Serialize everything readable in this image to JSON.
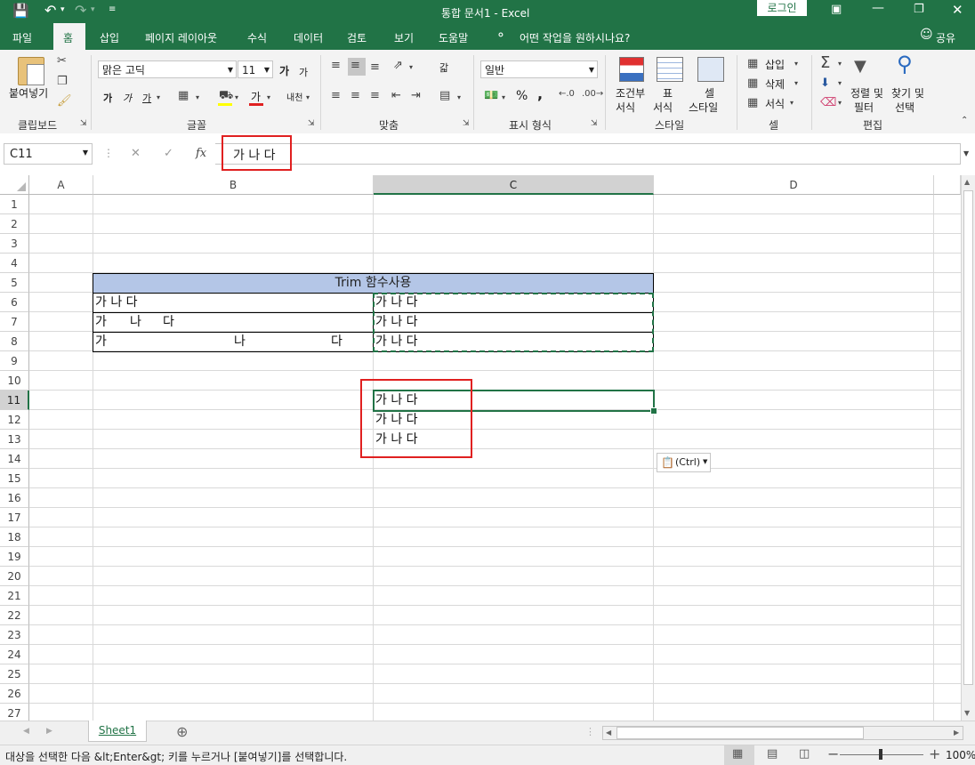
{
  "titlebar": {
    "document_title": "통합 문서1  -  Excel",
    "login_label": "로그인"
  },
  "tabs": [
    "파일",
    "홈",
    "삽입",
    "페이지 레이아웃",
    "수식",
    "데이터",
    "검토",
    "보기",
    "도움말"
  ],
  "tell_me": "어떤 작업을 원하시나요?",
  "share": "공유",
  "ribbon": {
    "clipboard": {
      "paste_label": "붙여넣기",
      "group_label": "클립보드"
    },
    "font": {
      "font_name": "맑은 고딕",
      "font_size": "11",
      "group_label": "글꼴",
      "bold": "가",
      "italic": "가",
      "underline": "가",
      "font_color": "가",
      "grow": "가",
      "shrink": "가",
      "phonetic": "내천"
    },
    "alignment": {
      "group_label": "맞춤",
      "wrap": "갋"
    },
    "number": {
      "format": "일반",
      "group_label": "표시 형식",
      "percent": "%",
      "comma": ","
    },
    "styles": {
      "conditional": "조건부\n서식",
      "conditional_l1": "조건부",
      "conditional_l2": "서식",
      "table_l1": "표",
      "table_l2": "서식",
      "cell_l1": "셀",
      "cell_l2": "스타일",
      "group_label": "스타일"
    },
    "cells": {
      "insert": "삽입",
      "delete": "삭제",
      "format": "서식",
      "group_label": "셀"
    },
    "editing": {
      "sort_l1": "정렬 및",
      "sort_l2": "필터",
      "find_l1": "찾기 및",
      "find_l2": "선택",
      "group_label": "편집"
    }
  },
  "formula_bar": {
    "name_box": "C11",
    "fx": "fx",
    "value": "가 나 다"
  },
  "columns": [
    "A",
    "B",
    "C",
    "D"
  ],
  "rows": [
    "1",
    "2",
    "3",
    "4",
    "5",
    "6",
    "7",
    "8",
    "9",
    "10",
    "11",
    "12",
    "13",
    "14",
    "15",
    "16",
    "17",
    "18",
    "19",
    "20",
    "21",
    "22",
    "23",
    "24",
    "25",
    "26",
    "27"
  ],
  "table": {
    "header": "Trim 함수사용",
    "b6": "가 나 다",
    "b7_1": "가",
    "b7_2": "나",
    "b7_3": "다",
    "b8_1": "가",
    "b8_2": "나",
    "b8_3": "다",
    "c6": "가 나 다",
    "c7": "가 나 다",
    "c8": "가 나 다",
    "c11": "가 나 다",
    "c12": "가 나 다",
    "c13": "가 나 다"
  },
  "paste_options": "(Ctrl)",
  "sheet_tab": "Sheet1",
  "status_text": "대상을 선택한 다음 &lt;Enter&gt; 키를 누르거나 [붙여넣기]를 선택합니다.",
  "zoom": "100%",
  "colors": {
    "excel_green": "#217346",
    "header_fill": "#b4c6e7",
    "highlight_red": "#e02020",
    "selection_green": "#217346"
  }
}
